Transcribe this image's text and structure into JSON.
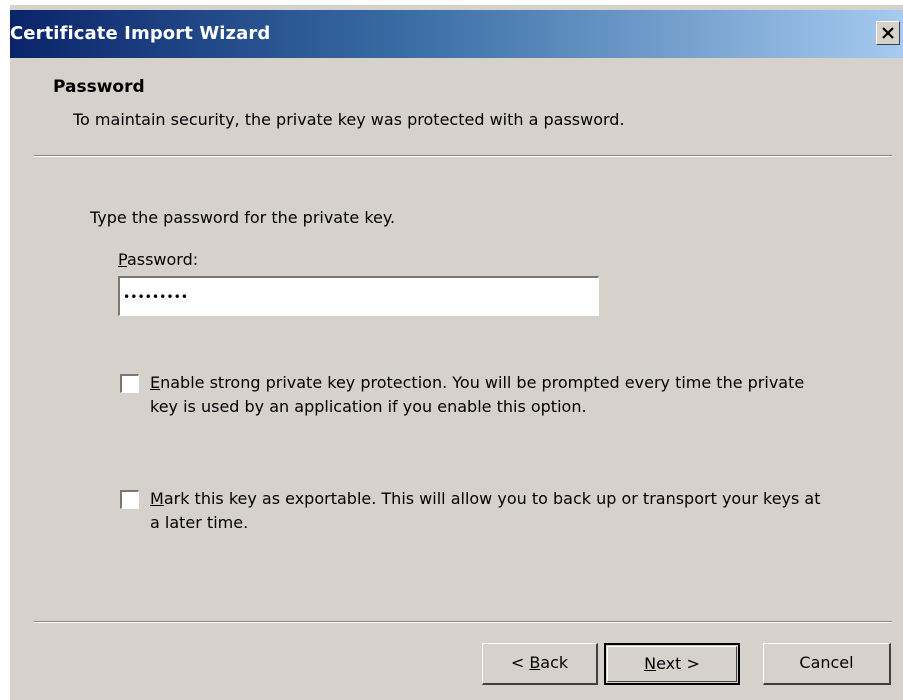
{
  "window": {
    "title": "Certificate Import Wizard"
  },
  "header": {
    "title": "Password",
    "subtitle": "To maintain security, the private key was protected with a password."
  },
  "body": {
    "instruction": "Type the password for the private key.",
    "password_label_first": "P",
    "password_label_rest": "assword:",
    "password_value": "*********",
    "checkbox_strong": {
      "checked": false,
      "label_first": "E",
      "label_rest": "nable strong private key protection. You will be prompted every time the private key is used by an application if you enable this option."
    },
    "checkbox_export": {
      "checked": false,
      "label_first": "M",
      "label_rest": "ark this key as exportable. This will allow you to back up or transport your keys at a later time."
    }
  },
  "buttons": {
    "back_prefix": "< ",
    "back_key": "B",
    "back_rest": "ack",
    "next_key": "N",
    "next_rest": "ext >",
    "cancel": "Cancel"
  },
  "icons": {
    "close": "close-icon"
  },
  "colors": {
    "title_start": "#0a246a",
    "title_end": "#a6caf0",
    "face": "#d6d2cb"
  }
}
